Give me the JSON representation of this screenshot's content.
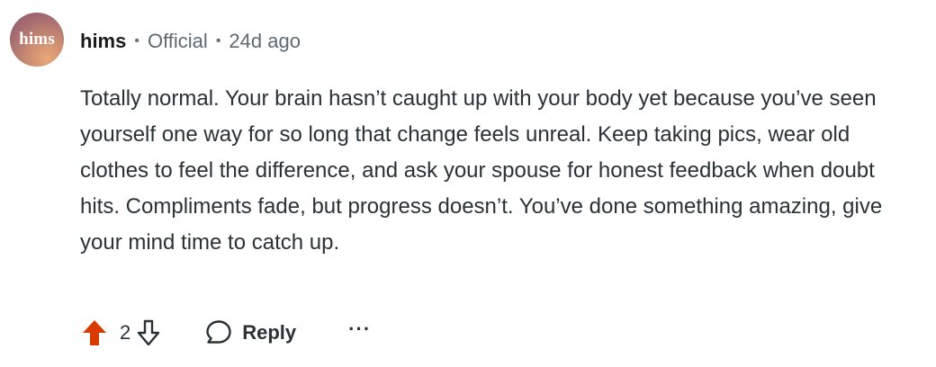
{
  "comment": {
    "avatar_text": "hims",
    "author": "hims",
    "flair": "Official",
    "time": "24d ago",
    "separator": "•",
    "body": "Totally normal. Your brain hasn’t caught up with your body yet because you’ve seen yourself one way for so long that change feels unreal. Keep taking pics, wear old clothes to feel the difference, and ask your spouse for honest feedback when doubt hits. Compliments fade, but progress doesn’t. You’ve done something amazing, give your mind time to catch up."
  },
  "actions": {
    "score": "2",
    "upvote_state": "active",
    "upvote_icon": "arrow-up-icon",
    "downvote_icon": "arrow-down-outline-icon",
    "reply_icon": "speech-bubble-icon",
    "reply_label": "Reply",
    "more_label": "···"
  },
  "colors": {
    "upvote_active": "#d93a00",
    "muted_text": "#5d6a73",
    "body_text": "#2a3236"
  }
}
